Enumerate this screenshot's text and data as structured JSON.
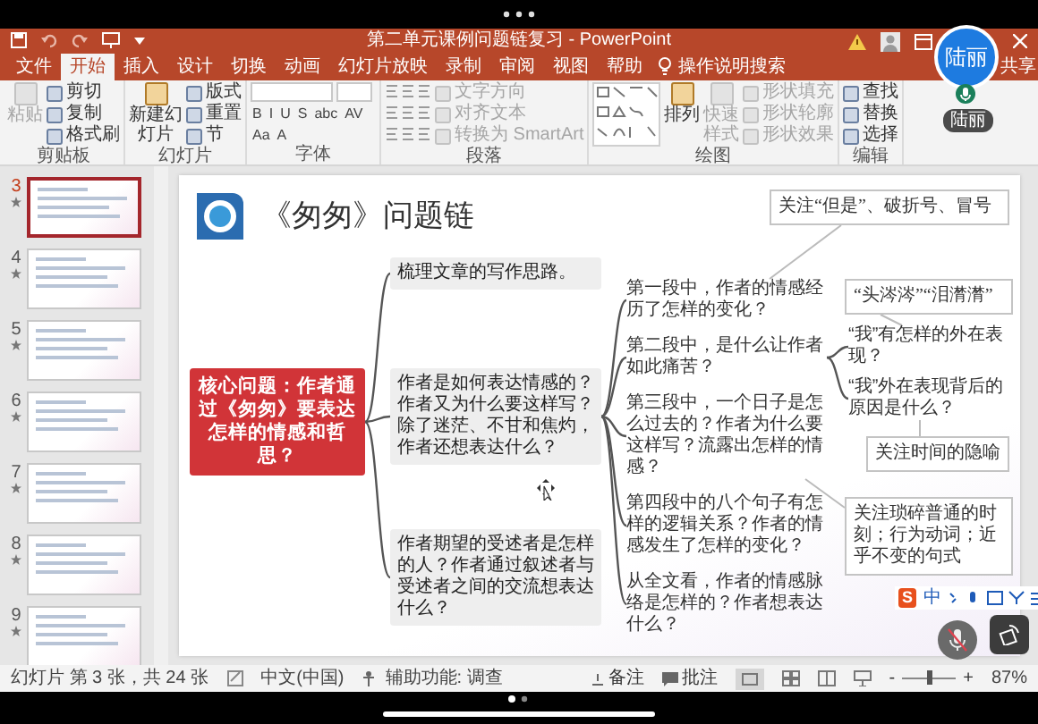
{
  "window": {
    "title": "第二单元课例问题链复习  -  PowerPoint"
  },
  "ribbon_tabs": [
    {
      "label": "文件",
      "selected": false
    },
    {
      "label": "开始",
      "selected": true
    },
    {
      "label": "插入",
      "selected": false
    },
    {
      "label": "设计",
      "selected": false
    },
    {
      "label": "切换",
      "selected": false
    },
    {
      "label": "动画",
      "selected": false
    },
    {
      "label": "幻灯片放映",
      "selected": false
    },
    {
      "label": "录制",
      "selected": false
    },
    {
      "label": "审阅",
      "selected": false
    },
    {
      "label": "视图",
      "selected": false
    },
    {
      "label": "帮助",
      "selected": false
    }
  ],
  "tell_me": "操作说明搜索",
  "share": "共享",
  "ribbon_groups": [
    {
      "label": "剪贴板",
      "items": [
        {
          "kind": "large",
          "label": "粘贴",
          "disabled": true
        },
        {
          "kind": "small",
          "label": "剪切",
          "disabled": false
        },
        {
          "kind": "small",
          "label": "复制",
          "disabled": false
        },
        {
          "kind": "small",
          "label": "格式刷",
          "disabled": false
        }
      ]
    },
    {
      "label": "幻灯片",
      "items": [
        {
          "kind": "large",
          "label": "新建幻灯片",
          "disabled": false
        },
        {
          "kind": "small",
          "label": "版式",
          "disabled": false
        },
        {
          "kind": "small",
          "label": "重置",
          "disabled": false
        },
        {
          "kind": "small",
          "label": "节",
          "disabled": false
        }
      ]
    },
    {
      "label": "字体",
      "items": [
        {
          "kind": "field"
        },
        {
          "kind": "field"
        },
        {
          "kind": "glyph",
          "label": "B"
        },
        {
          "kind": "glyph",
          "label": "I"
        },
        {
          "kind": "glyph",
          "label": "U"
        },
        {
          "kind": "glyph",
          "label": "S"
        },
        {
          "kind": "glyph",
          "label": "abc"
        },
        {
          "kind": "glyph",
          "label": "AV"
        },
        {
          "kind": "glyph",
          "label": "Aa"
        },
        {
          "kind": "glyph",
          "label": "A"
        }
      ]
    },
    {
      "label": "段落",
      "items": [
        {
          "kind": "paragraph_tools"
        },
        {
          "kind": "small",
          "label": "文字方向",
          "disabled": true
        },
        {
          "kind": "small",
          "label": "对齐文本",
          "disabled": true
        },
        {
          "kind": "small",
          "label": "转换为 SmartArt",
          "disabled": true
        }
      ]
    },
    {
      "label": "绘图",
      "items": [
        {
          "kind": "shape_gallery"
        },
        {
          "kind": "large",
          "label": "排列",
          "disabled": false
        },
        {
          "kind": "large",
          "label": "快速样式",
          "disabled": true
        },
        {
          "kind": "small",
          "label": "形状填充",
          "disabled": true
        },
        {
          "kind": "small",
          "label": "形状轮廓",
          "disabled": true
        },
        {
          "kind": "small",
          "label": "形状效果",
          "disabled": true
        }
      ]
    },
    {
      "label": "编辑",
      "items": [
        {
          "kind": "small",
          "label": "查找",
          "disabled": false
        },
        {
          "kind": "small",
          "label": "替换",
          "disabled": false
        },
        {
          "kind": "small",
          "label": "选择",
          "disabled": false
        }
      ]
    }
  ],
  "thumbnails": [
    {
      "number": "3",
      "selected": true
    },
    {
      "number": "4",
      "selected": false
    },
    {
      "number": "5",
      "selected": false
    },
    {
      "number": "6",
      "selected": false
    },
    {
      "number": "7",
      "selected": false
    },
    {
      "number": "8",
      "selected": false
    },
    {
      "number": "9",
      "selected": false
    }
  ],
  "slide": {
    "title": "《匆匆》问题链",
    "core": "核心问题：作者通过《匆匆》要表达怎样的情感和哲思？",
    "branches": [
      {
        "text": "梳理文章的写作思路。"
      },
      {
        "text": "作者是如何表达情感的？作者又为什么要这样写？除了迷茫、不甘和焦灼，作者还想表达什么？",
        "children": [
          {
            "text": "第一段中，作者的情感经历了怎样的变化？"
          },
          {
            "text": "第二段中，是什么让作者如此痛苦？",
            "children": [
              {
                "text": "“我”有怎样的外在表现？"
              },
              {
                "text": "“我”外在表现背后的原因是什么？"
              }
            ]
          },
          {
            "text": "第三段中，一个日子是怎么过去的？作者为什么要这样写？流露出怎样的情感？"
          },
          {
            "text": "第四段中的八个句子有怎样的逻辑关系？作者的情感发生了怎样的变化？"
          },
          {
            "text": "从全文看，作者的情感脉络是怎样的？作者想表达什么？"
          }
        ]
      },
      {
        "text": "作者期望的受述者是怎样的人？作者通过叙述者与受述者之间的交流想表达什么？"
      }
    ],
    "notes": [
      "关注“但是”、破折号、冒号",
      "“头涔涔”“泪潸潸”",
      "关注时间的隐喻",
      "关注琐碎普通的时刻；行为动词；近乎不变的句式"
    ]
  },
  "ime": {
    "logo": "S",
    "mode": "中"
  },
  "participant": {
    "avatar": "陆丽",
    "badge": "陆丽"
  },
  "status_bar": {
    "slide_info": "幻灯片 第 3 张，共 24 张",
    "language": "中文(中国)",
    "accessibility": "辅助功能: 调查",
    "notes": "备注",
    "comments": "批注",
    "zoom_minus": "-",
    "zoom_plus": "+",
    "zoom_slider": {
      "level": 0.5
    },
    "zoom": "87%"
  }
}
